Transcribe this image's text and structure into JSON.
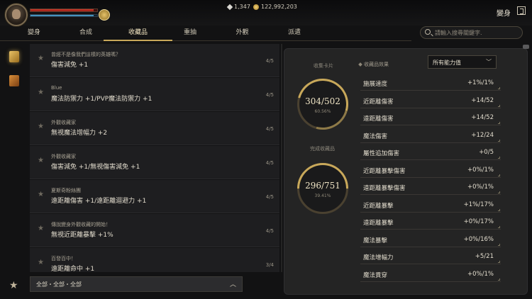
{
  "player": {
    "level": ""
  },
  "currency": {
    "gems": "1,347",
    "gold": "122,992,203"
  },
  "page_title": "變身",
  "tabs": [
    {
      "label": "變身"
    },
    {
      "label": "合成"
    },
    {
      "label": "收藏品"
    },
    {
      "label": "重抽"
    },
    {
      "label": "外觀"
    },
    {
      "label": "派遣"
    }
  ],
  "search": {
    "placeholder": "請輸入搜尋關鍵字."
  },
  "collections": [
    {
      "title": "曾經不是像我們這樣的英雄嗎？",
      "bonus": "傷害減免 +1",
      "count": "4/5"
    },
    {
      "title": "Blue",
      "bonus": "魔法防禦力 +1/PVP魔法防禦力 +1",
      "count": "4/5"
    },
    {
      "title": "外觀收藏家",
      "bonus": "無視魔法增幅力 +2",
      "count": "4/5"
    },
    {
      "title": "外觀收藏家",
      "bonus": "傷害減免 +1/無視傷害減免 +1",
      "count": "4/5"
    },
    {
      "title": "夏斯奇粉絲團",
      "bonus": "遠距離傷害 +1/遠距離迴避力 +1",
      "count": "4/5"
    },
    {
      "title": "傳說變身外觀收藏的開始！",
      "bonus": "無視近距離暴擊 +1%",
      "count": "4/5"
    },
    {
      "title": "百發百中！",
      "bonus": "遠距離命中 +1",
      "count": "3/4"
    }
  ],
  "filter": {
    "label": "全部・全部・全部"
  },
  "progress": {
    "cards_label": "收集卡片",
    "cards_value": "304/502",
    "cards_pct": "60.56%",
    "completed_label": "完成收藏品",
    "completed_value": "296/751",
    "completed_pct": "39.41%"
  },
  "effects": {
    "label": "收藏品效果",
    "select": "所有能力值",
    "stats": [
      {
        "name": "施展速度",
        "value": "+1%/1%"
      },
      {
        "name": "近距離傷害",
        "value": "+14/52"
      },
      {
        "name": "遠距離傷害",
        "value": "+14/52"
      },
      {
        "name": "魔法傷害",
        "value": "+12/24"
      },
      {
        "name": "屬性追加傷害",
        "value": "+0/5"
      },
      {
        "name": "近距離暴擊傷害",
        "value": "+0%/1%"
      },
      {
        "name": "遠距離暴擊傷害",
        "value": "+0%/1%"
      },
      {
        "name": "近距離暴擊",
        "value": "+1%/17%"
      },
      {
        "name": "遠距離暴擊",
        "value": "+0%/17%"
      },
      {
        "name": "魔法暴擊",
        "value": "+0%/16%"
      },
      {
        "name": "魔法增幅力",
        "value": "+5/21"
      },
      {
        "name": "魔法貫穿",
        "value": "+0%/1%"
      }
    ]
  },
  "colors": {
    "accent": "#c8a85a",
    "hp": "#d63b2c",
    "mp": "#5eb3e0"
  },
  "bars": {
    "hp_fraction": 0.95,
    "mp_fraction": 0.95
  },
  "icons": [
    "avatar",
    "hp-bar",
    "mp-bar",
    "gem-icon",
    "coin-icon",
    "close-icon",
    "search-icon",
    "book-icon",
    "star-icon",
    "chevron-up-icon",
    "chevron-down-icon"
  ]
}
